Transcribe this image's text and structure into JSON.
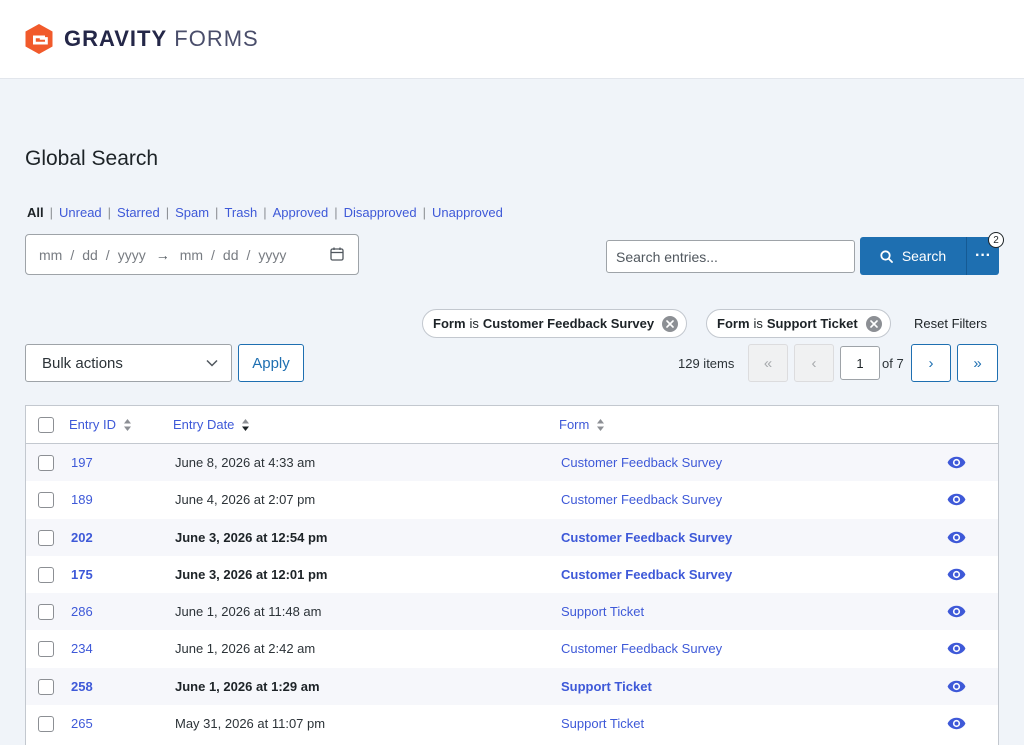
{
  "brand": {
    "name_bold": "GRAVITY",
    "name_light": "FORMS",
    "logo_icon": "gravity-forms-logo-icon",
    "accent_color": "#f15a2b"
  },
  "page": {
    "title": "Global Search"
  },
  "views": {
    "items": [
      {
        "label": "All",
        "active": true
      },
      {
        "label": "Unread"
      },
      {
        "label": "Starred"
      },
      {
        "label": "Spam"
      },
      {
        "label": "Trash"
      },
      {
        "label": "Approved"
      },
      {
        "label": "Disapproved"
      },
      {
        "label": "Unapproved"
      }
    ],
    "separator": "|"
  },
  "date_range": {
    "start": {
      "mm": "mm",
      "dd": "dd",
      "yyyy": "yyyy"
    },
    "end": {
      "mm": "mm",
      "dd": "dd",
      "yyyy": "yyyy"
    },
    "slash": "/",
    "arrow": "→",
    "calendar_icon": "calendar-icon"
  },
  "search": {
    "placeholder": "Search entries...",
    "value": "",
    "button_label": "Search",
    "more_label": "···",
    "badge_count": "2",
    "primary_color": "#1e6fb1"
  },
  "filters": {
    "chips": [
      {
        "field": "Form",
        "operator": "is",
        "value": "Customer Feedback Survey"
      },
      {
        "field": "Form",
        "operator": "is",
        "value": "Support Ticket"
      }
    ],
    "reset_label": "Reset Filters"
  },
  "bulk_actions": {
    "selected": "Bulk actions",
    "apply_label": "Apply"
  },
  "pagination": {
    "items_count": "129 items",
    "first": "«",
    "prev": "‹",
    "current_page": "1",
    "of_pages": "of 7",
    "next": "›",
    "last": "»"
  },
  "table": {
    "columns": {
      "entry_id": "Entry ID",
      "entry_date": "Entry Date",
      "form": "Form"
    },
    "rows": [
      {
        "id": "197",
        "date": "June 8, 2026 at 4:33 am",
        "form": "Customer Feedback Survey",
        "unread": false
      },
      {
        "id": "189",
        "date": "June 4, 2026 at 2:07 pm",
        "form": "Customer Feedback Survey",
        "unread": false
      },
      {
        "id": "202",
        "date": "June 3, 2026 at 12:54 pm",
        "form": "Customer Feedback Survey",
        "unread": true
      },
      {
        "id": "175",
        "date": "June 3, 2026 at 12:01 pm",
        "form": "Customer Feedback Survey",
        "unread": true
      },
      {
        "id": "286",
        "date": "June 1, 2026 at 11:48 am",
        "form": "Support Ticket",
        "unread": false
      },
      {
        "id": "234",
        "date": "June 1, 2026 at 2:42 am",
        "form": "Customer Feedback Survey",
        "unread": false
      },
      {
        "id": "258",
        "date": "June 1, 2026 at 1:29 am",
        "form": "Support Ticket",
        "unread": true
      },
      {
        "id": "265",
        "date": "May 31, 2026 at 11:07 pm",
        "form": "Support Ticket",
        "unread": false
      }
    ],
    "view_icon": "eye-icon"
  }
}
